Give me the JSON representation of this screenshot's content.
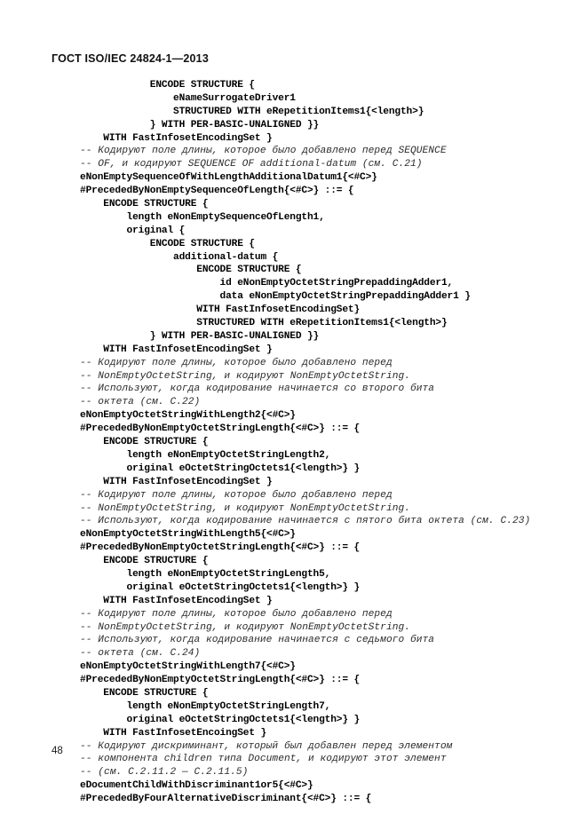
{
  "header": {
    "standard_title": "ГОСТ ISO/IEC 24824-1—2013"
  },
  "footer": {
    "page_number": "48"
  },
  "code": {
    "lines": [
      {
        "kind": "src",
        "text": "            ENCODE STRUCTURE {"
      },
      {
        "kind": "src",
        "text": "                eNameSurrogateDriver1"
      },
      {
        "kind": "src",
        "text": "                STRUCTURED WITH eRepetitionItems1{<length>}"
      },
      {
        "kind": "src",
        "text": "            } WITH PER-BASIC-UNALIGNED }}"
      },
      {
        "kind": "src",
        "text": "    WITH FastInfosetEncodingSet }"
      },
      {
        "kind": "comment",
        "text": "-- Кодируют поле длины, которое было добавлено перед SEQUENCE"
      },
      {
        "kind": "comment",
        "text": "-- OF, и кодируют SEQUENCE OF additional-datum (см. C.21)"
      },
      {
        "kind": "src",
        "text": "eNonEmptySequenceOfWithLengthAdditionalDatum1{<#C>}"
      },
      {
        "kind": "src",
        "text": "#PrecededByNonEmptySequenceOfLength{<#C>} ::= {"
      },
      {
        "kind": "src",
        "text": "    ENCODE STRUCTURE {"
      },
      {
        "kind": "src",
        "text": "        length eNonEmptySequenceOfLength1,"
      },
      {
        "kind": "src",
        "text": "        original {"
      },
      {
        "kind": "src",
        "text": "            ENCODE STRUCTURE {"
      },
      {
        "kind": "src",
        "text": "                additional-datum {"
      },
      {
        "kind": "src",
        "text": "                    ENCODE STRUCTURE {"
      },
      {
        "kind": "src",
        "text": "                        id eNonEmptyOctetStringPrepaddingAdder1,"
      },
      {
        "kind": "src",
        "text": "                        data eNonEmptyOctetStringPrepaddingAdder1 }"
      },
      {
        "kind": "src",
        "text": "                    WITH FastInfosetEncodingSet}"
      },
      {
        "kind": "src",
        "text": "                    STRUCTURED WITH eRepetitionItems1{<length>}"
      },
      {
        "kind": "src",
        "text": "            } WITH PER-BASIC-UNALIGNED }}"
      },
      {
        "kind": "src",
        "text": "    WITH FastInfosetEncodingSet }"
      },
      {
        "kind": "comment",
        "text": "-- Кодируют поле длины, которое было добавлено перед"
      },
      {
        "kind": "comment",
        "text": "-- NonEmptyOctetString, и кодируют NonEmptyOctetString."
      },
      {
        "kind": "comment",
        "text": "-- Используют, когда кодирование начинается со второго бита"
      },
      {
        "kind": "comment",
        "text": "-- октета (см. C.22)"
      },
      {
        "kind": "src",
        "text": "eNonEmptyOctetStringWithLength2{<#C>}"
      },
      {
        "kind": "src",
        "text": "#PrecededByNonEmptyOctetStringLength{<#C>} ::= {"
      },
      {
        "kind": "src",
        "text": "    ENCODE STRUCTURE {"
      },
      {
        "kind": "src",
        "text": "        length eNonEmptyOctetStringLength2,"
      },
      {
        "kind": "src",
        "text": "        original eOctetStringOctets1{<length>} }"
      },
      {
        "kind": "src",
        "text": "    WITH FastInfosetEncodingSet }"
      },
      {
        "kind": "comment",
        "text": "-- Кодируют поле длины, которое было добавлено перед"
      },
      {
        "kind": "comment",
        "text": "-- NonEmptyOctetString, и кодируют NonEmptyOctetString."
      },
      {
        "kind": "comment",
        "text": "-- Используют, когда кодирование начинается с пятого бита октета (см. C.23)"
      },
      {
        "kind": "src",
        "text": "eNonEmptyOctetStringWithLength5{<#C>}"
      },
      {
        "kind": "src",
        "text": "#PrecededByNonEmptyOctetStringLength{<#C>} ::= {"
      },
      {
        "kind": "src",
        "text": "    ENCODE STRUCTURE {"
      },
      {
        "kind": "src",
        "text": "        length eNonEmptyOctetStringLength5,"
      },
      {
        "kind": "src",
        "text": "        original eOctetStringOctets1{<length>} }"
      },
      {
        "kind": "src",
        "text": "    WITH FastInfosetEncodingSet }"
      },
      {
        "kind": "comment",
        "text": "-- Кодируют поле длины, которое было добавлено перед"
      },
      {
        "kind": "comment",
        "text": "-- NonEmptyOctetString, и кодируют NonEmptyOctetString."
      },
      {
        "kind": "comment",
        "text": "-- Используют, когда кодирование начинается с седьмого бита"
      },
      {
        "kind": "comment",
        "text": "-- октета (см. C.24)"
      },
      {
        "kind": "src",
        "text": "eNonEmptyOctetStringWithLength7{<#C>}"
      },
      {
        "kind": "src",
        "text": "#PrecededByNonEmptyOctetStringLength{<#C>} ::= {"
      },
      {
        "kind": "src",
        "text": "    ENCODE STRUCTURE {"
      },
      {
        "kind": "src",
        "text": "        length eNonEmptyOctetStringLength7,"
      },
      {
        "kind": "src",
        "text": "        original eOctetStringOctets1{<length>} }"
      },
      {
        "kind": "src",
        "text": "    WITH FastInfosetEncoingSet }"
      },
      {
        "kind": "comment",
        "text": "-- Кодируют дискриминант, который был добавлен перед элементом"
      },
      {
        "kind": "comment",
        "text": "-- компонента children типа Document, и кодируют этот элемент"
      },
      {
        "kind": "comment",
        "text": "-- (см. C.2.11.2 — C.2.11.5)"
      },
      {
        "kind": "src",
        "text": "eDocumentChildWithDiscriminant1or5{<#C>}"
      },
      {
        "kind": "src",
        "text": "#PrecededByFourAlternativeDiscriminant{<#C>} ::= {"
      }
    ]
  }
}
